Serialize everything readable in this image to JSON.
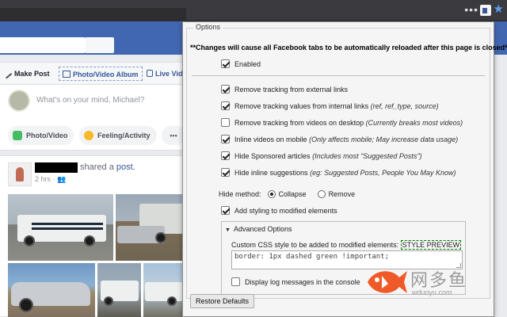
{
  "browser": {
    "menu_dots": "•••",
    "extension_icon": "puzzle-extension-icon",
    "bookmark_icon": "star-icon"
  },
  "composer": {
    "tabs": [
      "Make Post",
      "Photo/Video Album",
      "Live Vid"
    ],
    "prompt": "What's on your mind, Michael?",
    "actions": [
      "Photo/Video",
      "Feeling/Activity",
      "•••"
    ]
  },
  "post": {
    "action_prefix": "shared a",
    "action_link": "post.",
    "meta": "2 hrs · 👥"
  },
  "options": {
    "legend": "Options",
    "notice": "**Changes will cause all Facebook tabs to be automatically reloaded after this page is closed**",
    "enabled": {
      "label": "Enabled",
      "checked": true
    },
    "settings": [
      {
        "label": "Remove tracking from external links",
        "note": "",
        "checked": true
      },
      {
        "label": "Remove tracking values from internal links",
        "note": "(ref, ref_type, source)",
        "checked": true
      },
      {
        "label": "Remove tracking from videos on desktop",
        "note": "(Currently breaks most videos)",
        "checked": false
      },
      {
        "label": "Inline videos on mobile",
        "note": "(Only affects mobile; May increase data usage)",
        "checked": true
      },
      {
        "label": "Hide Sponsored articles",
        "note": "(Includes most \"Suggested Posts\")",
        "checked": true
      },
      {
        "label": "Hide inline suggestions",
        "note": "(eg: Suggested Posts, People You May Know)",
        "checked": true
      }
    ],
    "hide_method": {
      "label": "Hide method:",
      "options": [
        "Collapse",
        "Remove"
      ],
      "selected": "Collapse"
    },
    "add_styling": {
      "label": "Add styling to modified elements",
      "checked": true
    },
    "advanced": {
      "summary": "Advanced Options",
      "css_label": "Custom CSS style to be added to modified elements:",
      "style_preview": "STYLE PREVIEW",
      "css_value": "border: 1px dashed green !important;",
      "log": {
        "label": "Display log messages in the console",
        "checked": false
      }
    },
    "restore_button": "Restore Defaults"
  },
  "watermark": {
    "chinese": "网多鱼",
    "url": "wduoyu.com"
  }
}
